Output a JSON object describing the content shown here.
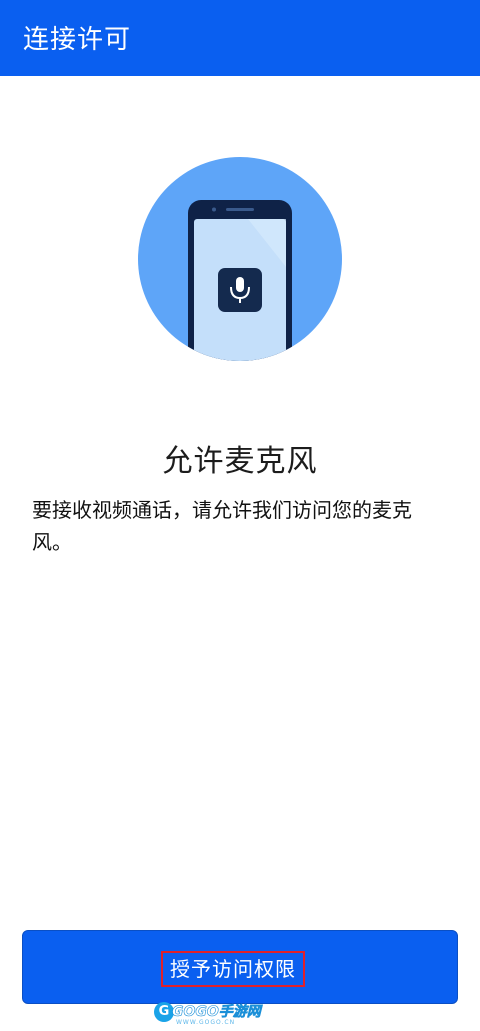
{
  "header": {
    "title": "连接许可"
  },
  "illustration": {
    "icon": "microphone-icon",
    "colors": {
      "circle": "#5ea5f8",
      "phone_frame": "#0f2247",
      "phone_screen": "#c4dffa",
      "mic_tile": "#142a4e"
    }
  },
  "permission": {
    "title": "允许麦克风",
    "description": "要接收视频通话，请允许我们访问您的麦克风。"
  },
  "grant_button": {
    "label": "授予访问权限"
  },
  "watermark": {
    "logo_letter": "G",
    "text": "GOGO手游网",
    "sub": "WWW.GOGO.CN"
  },
  "colors": {
    "primary": "#0a5ff0",
    "highlight_box": "#e0202a"
  }
}
